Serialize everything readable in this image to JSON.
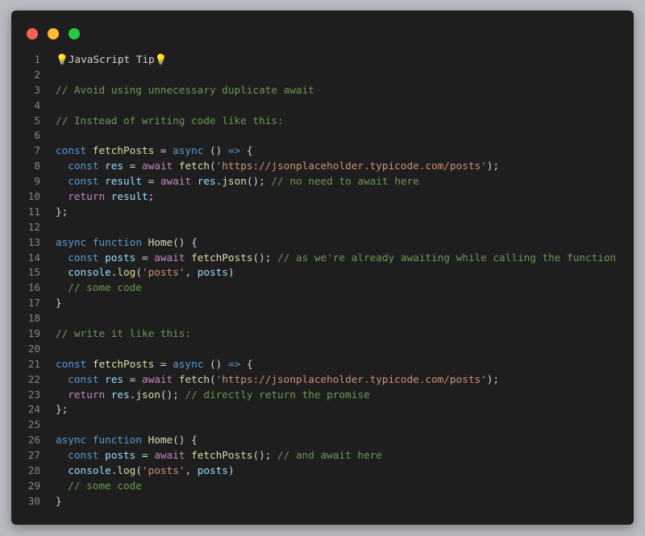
{
  "window": {
    "controls": [
      {
        "name": "close",
        "color": "#ff5f57"
      },
      {
        "name": "minimize",
        "color": "#febc2e"
      },
      {
        "name": "maximize",
        "color": "#28c840"
      }
    ]
  },
  "code": {
    "lines": [
      {
        "number": "1",
        "tokens": [
          {
            "text": "💡JavaScript Tip💡",
            "type": "pl"
          }
        ]
      },
      {
        "number": "2",
        "tokens": []
      },
      {
        "number": "3",
        "tokens": [
          {
            "text": "// Avoid using unnecessary duplicate await",
            "type": "cm"
          }
        ]
      },
      {
        "number": "4",
        "tokens": []
      },
      {
        "number": "5",
        "tokens": [
          {
            "text": "// Instead of writing code like this:",
            "type": "cm"
          }
        ]
      },
      {
        "number": "6",
        "tokens": []
      },
      {
        "number": "7",
        "tokens": [
          {
            "text": "const",
            "type": "kw"
          },
          {
            "text": " ",
            "type": "pl"
          },
          {
            "text": "fetchPosts",
            "type": "fn"
          },
          {
            "text": " = ",
            "type": "pl"
          },
          {
            "text": "async",
            "type": "kw"
          },
          {
            "text": " () ",
            "type": "pl"
          },
          {
            "text": "=>",
            "type": "kw"
          },
          {
            "text": " {",
            "type": "pl"
          }
        ]
      },
      {
        "number": "8",
        "tokens": [
          {
            "text": "  ",
            "type": "pl"
          },
          {
            "text": "const",
            "type": "kw"
          },
          {
            "text": " ",
            "type": "pl"
          },
          {
            "text": "res",
            "type": "vr"
          },
          {
            "text": " = ",
            "type": "pl"
          },
          {
            "text": "await",
            "type": "ctl"
          },
          {
            "text": " ",
            "type": "pl"
          },
          {
            "text": "fetch",
            "type": "fn"
          },
          {
            "text": "(",
            "type": "pl"
          },
          {
            "text": "'https://jsonplaceholder.typicode.com/posts'",
            "type": "str"
          },
          {
            "text": ");",
            "type": "pl"
          }
        ]
      },
      {
        "number": "9",
        "tokens": [
          {
            "text": "  ",
            "type": "pl"
          },
          {
            "text": "const",
            "type": "kw"
          },
          {
            "text": " ",
            "type": "pl"
          },
          {
            "text": "result",
            "type": "vr"
          },
          {
            "text": " = ",
            "type": "pl"
          },
          {
            "text": "await",
            "type": "ctl"
          },
          {
            "text": " ",
            "type": "pl"
          },
          {
            "text": "res",
            "type": "vr"
          },
          {
            "text": ".",
            "type": "pl"
          },
          {
            "text": "json",
            "type": "fn"
          },
          {
            "text": "(); ",
            "type": "pl"
          },
          {
            "text": "// no need to await here",
            "type": "cm"
          }
        ]
      },
      {
        "number": "10",
        "tokens": [
          {
            "text": "  ",
            "type": "pl"
          },
          {
            "text": "return",
            "type": "ctl"
          },
          {
            "text": " ",
            "type": "pl"
          },
          {
            "text": "result",
            "type": "vr"
          },
          {
            "text": ";",
            "type": "pl"
          }
        ]
      },
      {
        "number": "11",
        "tokens": [
          {
            "text": "};",
            "type": "pl"
          }
        ]
      },
      {
        "number": "12",
        "tokens": []
      },
      {
        "number": "13",
        "tokens": [
          {
            "text": "async",
            "type": "kw"
          },
          {
            "text": " ",
            "type": "pl"
          },
          {
            "text": "function",
            "type": "kw"
          },
          {
            "text": " ",
            "type": "pl"
          },
          {
            "text": "Home",
            "type": "fn"
          },
          {
            "text": "() {",
            "type": "pl"
          }
        ]
      },
      {
        "number": "14",
        "tokens": [
          {
            "text": "  ",
            "type": "pl"
          },
          {
            "text": "const",
            "type": "kw"
          },
          {
            "text": " ",
            "type": "pl"
          },
          {
            "text": "posts",
            "type": "vr"
          },
          {
            "text": " = ",
            "type": "pl"
          },
          {
            "text": "await",
            "type": "ctl"
          },
          {
            "text": " ",
            "type": "pl"
          },
          {
            "text": "fetchPosts",
            "type": "fn"
          },
          {
            "text": "(); ",
            "type": "pl"
          },
          {
            "text": "// as we're already awaiting while calling the function",
            "type": "cm"
          }
        ]
      },
      {
        "number": "15",
        "tokens": [
          {
            "text": "  ",
            "type": "pl"
          },
          {
            "text": "console",
            "type": "vr"
          },
          {
            "text": ".",
            "type": "pl"
          },
          {
            "text": "log",
            "type": "fn"
          },
          {
            "text": "(",
            "type": "pl"
          },
          {
            "text": "'posts'",
            "type": "str"
          },
          {
            "text": ", ",
            "type": "pl"
          },
          {
            "text": "posts",
            "type": "vr"
          },
          {
            "text": ")",
            "type": "pl"
          }
        ]
      },
      {
        "number": "16",
        "tokens": [
          {
            "text": "  ",
            "type": "pl"
          },
          {
            "text": "// some code",
            "type": "cm"
          }
        ]
      },
      {
        "number": "17",
        "tokens": [
          {
            "text": "}",
            "type": "pl"
          }
        ]
      },
      {
        "number": "18",
        "tokens": []
      },
      {
        "number": "19",
        "tokens": [
          {
            "text": "// write it like this:",
            "type": "cm"
          }
        ]
      },
      {
        "number": "20",
        "tokens": []
      },
      {
        "number": "21",
        "tokens": [
          {
            "text": "const",
            "type": "kw"
          },
          {
            "text": " ",
            "type": "pl"
          },
          {
            "text": "fetchPosts",
            "type": "fn"
          },
          {
            "text": " = ",
            "type": "pl"
          },
          {
            "text": "async",
            "type": "kw"
          },
          {
            "text": " () ",
            "type": "pl"
          },
          {
            "text": "=>",
            "type": "kw"
          },
          {
            "text": " {",
            "type": "pl"
          }
        ]
      },
      {
        "number": "22",
        "tokens": [
          {
            "text": "  ",
            "type": "pl"
          },
          {
            "text": "const",
            "type": "kw"
          },
          {
            "text": " ",
            "type": "pl"
          },
          {
            "text": "res",
            "type": "vr"
          },
          {
            "text": " = ",
            "type": "pl"
          },
          {
            "text": "await",
            "type": "ctl"
          },
          {
            "text": " ",
            "type": "pl"
          },
          {
            "text": "fetch",
            "type": "fn"
          },
          {
            "text": "(",
            "type": "pl"
          },
          {
            "text": "'https://jsonplaceholder.typicode.com/posts'",
            "type": "str"
          },
          {
            "text": ");",
            "type": "pl"
          }
        ]
      },
      {
        "number": "23",
        "tokens": [
          {
            "text": "  ",
            "type": "pl"
          },
          {
            "text": "return",
            "type": "ctl"
          },
          {
            "text": " ",
            "type": "pl"
          },
          {
            "text": "res",
            "type": "vr"
          },
          {
            "text": ".",
            "type": "pl"
          },
          {
            "text": "json",
            "type": "fn"
          },
          {
            "text": "(); ",
            "type": "pl"
          },
          {
            "text": "// directly return the promise",
            "type": "cm"
          }
        ]
      },
      {
        "number": "24",
        "tokens": [
          {
            "text": "};",
            "type": "pl"
          }
        ]
      },
      {
        "number": "25",
        "tokens": []
      },
      {
        "number": "26",
        "tokens": [
          {
            "text": "async",
            "type": "kw"
          },
          {
            "text": " ",
            "type": "pl"
          },
          {
            "text": "function",
            "type": "kw"
          },
          {
            "text": " ",
            "type": "pl"
          },
          {
            "text": "Home",
            "type": "fn"
          },
          {
            "text": "() {",
            "type": "pl"
          }
        ]
      },
      {
        "number": "27",
        "tokens": [
          {
            "text": "  ",
            "type": "pl"
          },
          {
            "text": "const",
            "type": "kw"
          },
          {
            "text": " ",
            "type": "pl"
          },
          {
            "text": "posts",
            "type": "vr"
          },
          {
            "text": " = ",
            "type": "pl"
          },
          {
            "text": "await",
            "type": "ctl"
          },
          {
            "text": " ",
            "type": "pl"
          },
          {
            "text": "fetchPosts",
            "type": "fn"
          },
          {
            "text": "(); ",
            "type": "pl"
          },
          {
            "text": "// and await here",
            "type": "cm"
          }
        ]
      },
      {
        "number": "28",
        "tokens": [
          {
            "text": "  ",
            "type": "pl"
          },
          {
            "text": "console",
            "type": "vr"
          },
          {
            "text": ".",
            "type": "pl"
          },
          {
            "text": "log",
            "type": "fn"
          },
          {
            "text": "(",
            "type": "pl"
          },
          {
            "text": "'posts'",
            "type": "str"
          },
          {
            "text": ", ",
            "type": "pl"
          },
          {
            "text": "posts",
            "type": "vr"
          },
          {
            "text": ")",
            "type": "pl"
          }
        ]
      },
      {
        "number": "29",
        "tokens": [
          {
            "text": "  ",
            "type": "pl"
          },
          {
            "text": "// some code",
            "type": "cm"
          }
        ]
      },
      {
        "number": "30",
        "tokens": [
          {
            "text": "}",
            "type": "pl"
          }
        ]
      }
    ]
  }
}
